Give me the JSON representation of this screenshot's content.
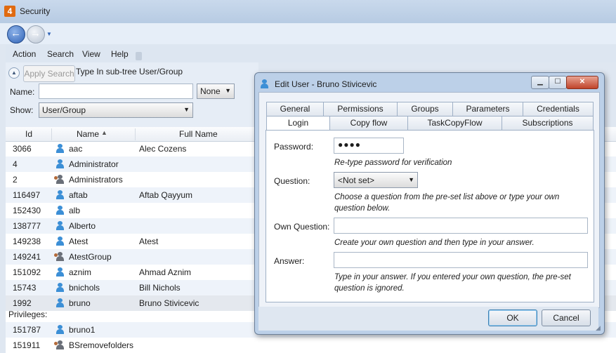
{
  "window": {
    "title": "Security",
    "app_icon_text": "4"
  },
  "nav": {
    "back": "back-arrow-icon",
    "forward": "forward-arrow-icon"
  },
  "menu": [
    "Action",
    "Search",
    "View",
    "Help"
  ],
  "search": {
    "apply_label": "Apply Search",
    "subtree_label": "Type In sub-tree User/Group",
    "name_label": "Name:",
    "name_value": "",
    "name_mode": "None",
    "show_label": "Show:",
    "show_value": "User/Group"
  },
  "table": {
    "columns": [
      "Id",
      "Name",
      "Full Name"
    ],
    "rows": [
      {
        "id": "3066",
        "name": "aac",
        "full_name": "Alec Cozens",
        "type": "user"
      },
      {
        "id": "4",
        "name": "Administrator",
        "full_name": "",
        "type": "user"
      },
      {
        "id": "2",
        "name": "Administrators",
        "full_name": "",
        "type": "group"
      },
      {
        "id": "116497",
        "name": "aftab",
        "full_name": "Aftab Qayyum",
        "type": "user"
      },
      {
        "id": "152430",
        "name": "alb",
        "full_name": "",
        "type": "user"
      },
      {
        "id": "138777",
        "name": "Alberto",
        "full_name": "",
        "type": "user"
      },
      {
        "id": "149238",
        "name": "Atest",
        "full_name": "Atest",
        "type": "user"
      },
      {
        "id": "149241",
        "name": "AtestGroup",
        "full_name": "",
        "type": "group"
      },
      {
        "id": "151092",
        "name": "aznim",
        "full_name": "Ahmad Aznim",
        "type": "user"
      },
      {
        "id": "15743",
        "name": "bnichols",
        "full_name": "Bill Nichols",
        "type": "user"
      },
      {
        "id": "1992",
        "name": "bruno",
        "full_name": "Bruno Stivicevic",
        "type": "user"
      },
      {
        "id": "151787",
        "name": "bruno1",
        "full_name": "",
        "type": "user"
      },
      {
        "id": "151911",
        "name": "BSremovefolders",
        "full_name": "",
        "type": "group"
      }
    ],
    "privileges_label": "Privileges:"
  },
  "dialog": {
    "title": "Edit User - Bruno Stivicevic",
    "tabs_row1": [
      "General",
      "Permissions",
      "Groups",
      "Parameters",
      "Credentials"
    ],
    "tabs_row2": [
      "Login",
      "Copy flow",
      "TaskCopyFlow",
      "Subscriptions"
    ],
    "active_tab": "Login",
    "password_label": "Password:",
    "password_value": "●●●●",
    "password_hint": "Re-type password for verification",
    "question_label": "Question:",
    "question_value": "<Not set>",
    "question_hint_1": "Choose a question from the pre-set list above or type your own",
    "question_hint_2": "question below.",
    "own_question_label": "Own Question:",
    "own_question_value": "",
    "own_question_hint": "Create your own question and then type in your answer.",
    "answer_label": "Answer:",
    "answer_value": "",
    "answer_hint_1": "Type in your answer. If you entered your own question, the pre-set",
    "answer_hint_2": "question is ignored.",
    "ok_label": "OK",
    "cancel_label": "Cancel"
  }
}
